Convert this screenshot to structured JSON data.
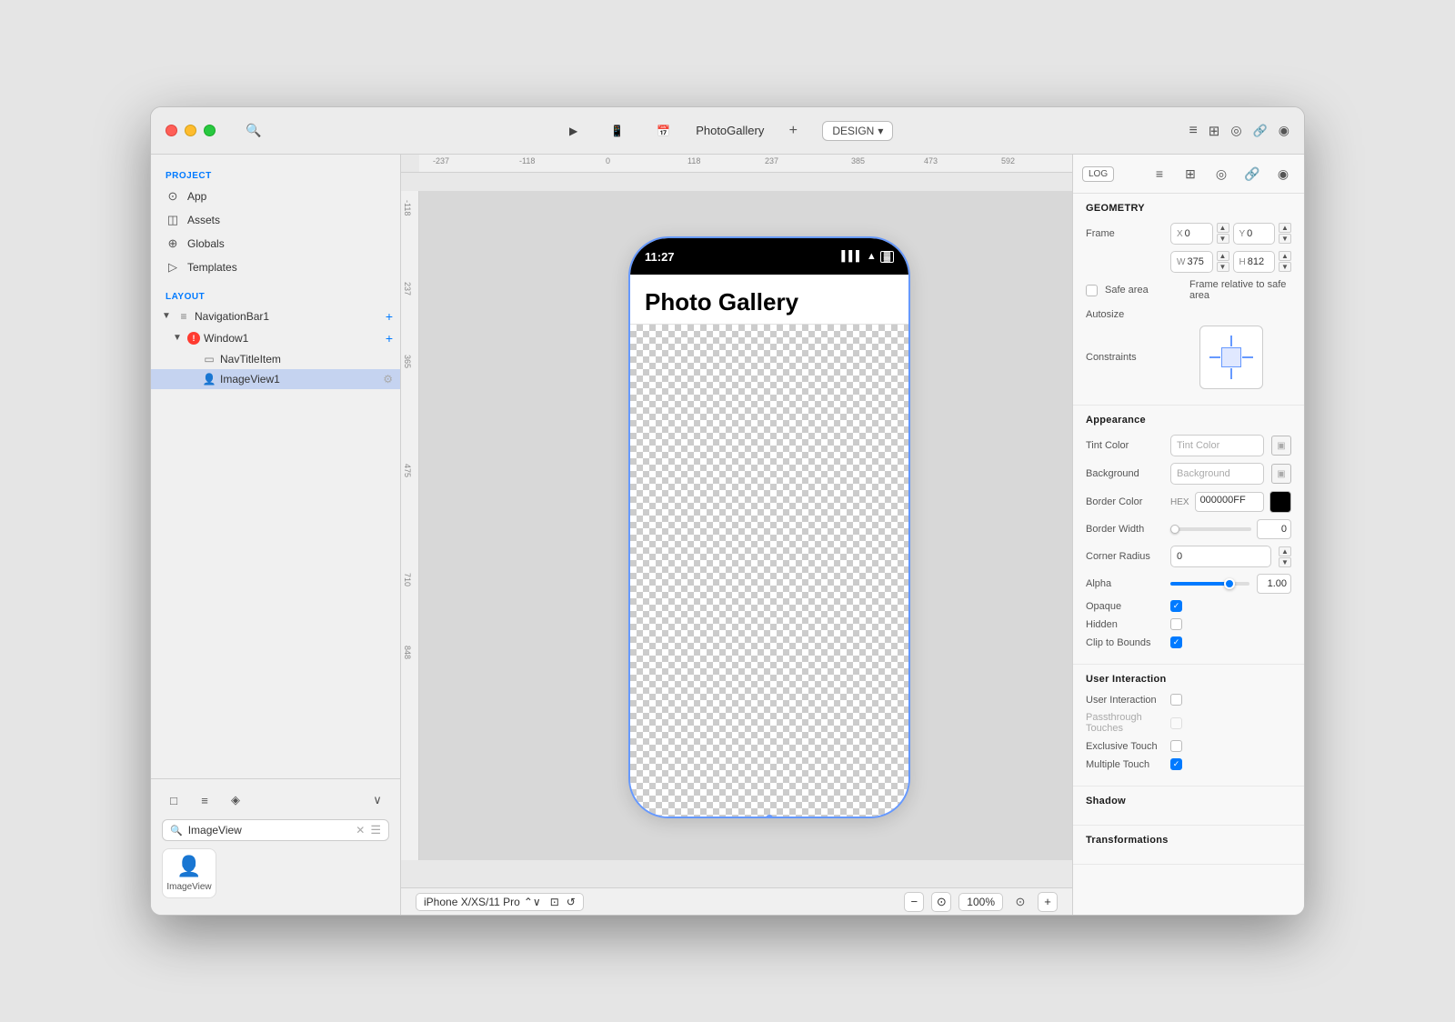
{
  "window": {
    "title": "PhotoGallery"
  },
  "titlebar": {
    "search_icon": "🔍",
    "run_btn": "▶",
    "device_btn": "📱",
    "calendar_btn": "📅",
    "plus_btn": "+",
    "design_label": "DESIGN",
    "log_btn": "LOG",
    "list_icon": "≡",
    "layout_icon": "⊞",
    "circle_icon": "◎",
    "link_icon": "🔗",
    "eye_icon": "◉"
  },
  "sidebar": {
    "project_label": "PROJECT",
    "layout_label": "LAYOUT",
    "items": [
      {
        "label": "App",
        "icon": "⊙"
      },
      {
        "label": "Assets",
        "icon": "◫"
      },
      {
        "label": "Globals",
        "icon": "⊕"
      },
      {
        "label": "Templates",
        "icon": "▷"
      }
    ],
    "tree": [
      {
        "label": "NavigationBar1",
        "icon": "≡",
        "indent": 0,
        "expanded": true,
        "has_add": true
      },
      {
        "label": "Window1",
        "indent": 0,
        "expanded": true,
        "has_add": true,
        "has_warn": true
      },
      {
        "label": "NavTitleItem",
        "indent": 1,
        "icon": "▭"
      },
      {
        "label": "ImageView1",
        "indent": 1,
        "icon": "👤",
        "selected": true,
        "has_settings": true
      }
    ],
    "search_placeholder": "ImageView",
    "component_icon": "👤"
  },
  "canvas": {
    "device_label": "iPhone X/XS/11 Pro",
    "zoom_level": "100%",
    "ruler_labels": [
      "-237",
      "-118",
      "0",
      "118",
      "237",
      "385",
      "473",
      "592"
    ]
  },
  "phone": {
    "time": "11:27",
    "nav_title": "Photo Gallery"
  },
  "right_panel": {
    "log_btn": "LOG",
    "geometry_title": "GEOMETRY",
    "frame_label": "Frame",
    "x_label": "X",
    "x_value": "0",
    "y_label": "Y",
    "y_value": "0",
    "w_label": "W",
    "w_value": "375",
    "h_label": "H",
    "h_value": "812",
    "safe_area_label": "Safe area",
    "frame_relative_label": "Frame relative to safe area",
    "autosize_label": "Autosize",
    "constraints_label": "Constraints",
    "appearance_title": "Appearance",
    "tint_color_label": "Tint Color",
    "tint_color_placeholder": "Tint Color",
    "background_label": "Background",
    "background_placeholder": "Background",
    "border_color_label": "Border Color",
    "border_hex_label": "HEX",
    "border_hex_value": "000000FF",
    "border_width_label": "Border Width",
    "border_width_value": "0",
    "corner_radius_label": "Corner Radius",
    "corner_radius_value": "0",
    "alpha_label": "Alpha",
    "alpha_value": "1.00",
    "opaque_label": "Opaque",
    "hidden_label": "Hidden",
    "clip_bounds_label": "Clip to Bounds",
    "user_interaction_title": "User Interaction",
    "user_interaction_label": "User Interaction",
    "passthrough_label": "Passthrough Touches",
    "exclusive_label": "Exclusive Touch",
    "multiple_label": "Multiple Touch",
    "shadow_title": "Shadow",
    "transformations_title": "Transformations"
  }
}
